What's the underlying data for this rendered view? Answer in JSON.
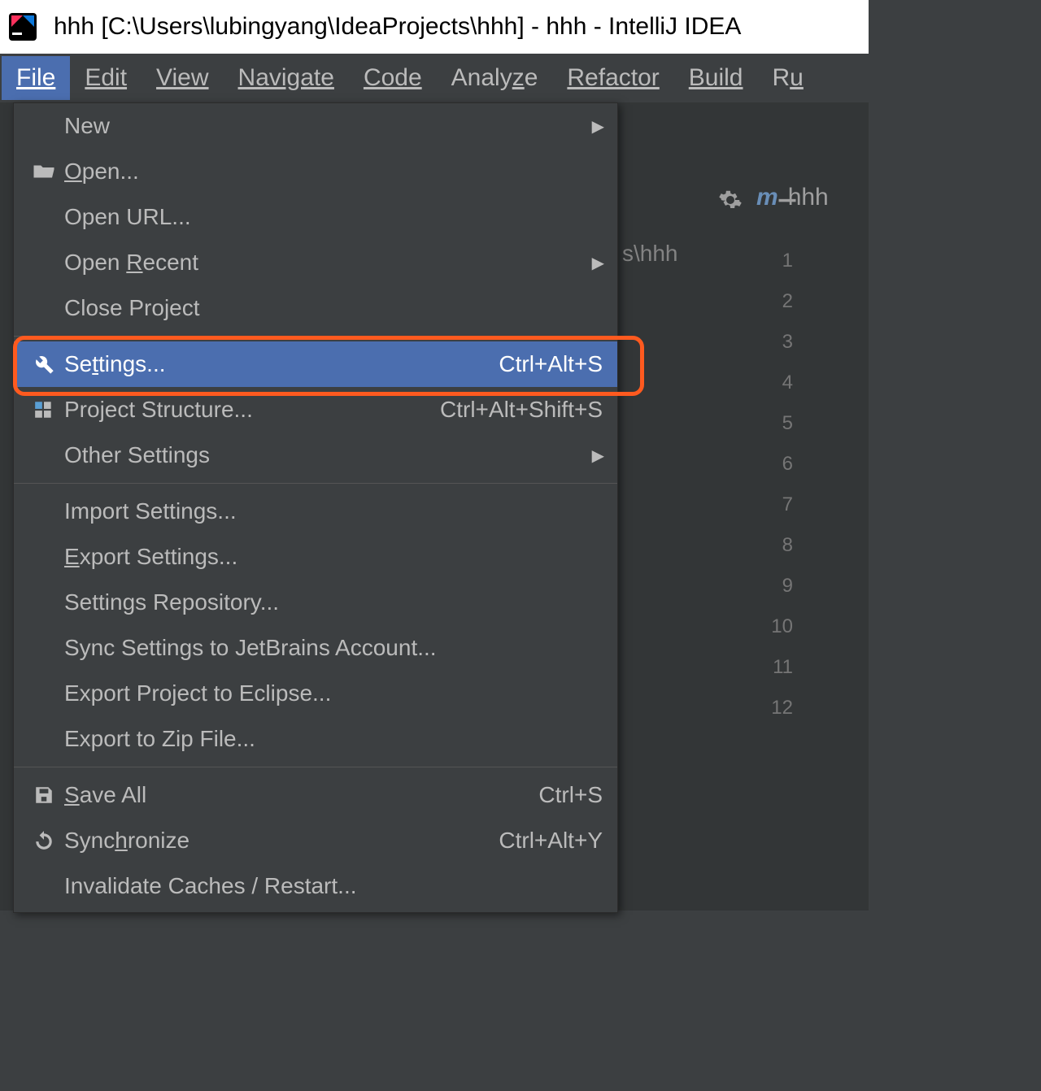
{
  "title": "hhh [C:\\Users\\lubingyang\\IdeaProjects\\hhh] - hhh - IntelliJ IDEA",
  "menubar": {
    "file": "File",
    "edit": "Edit",
    "view": "View",
    "navigate": "Navigate",
    "code": "Code",
    "analyze": "Analyze",
    "refactor": "Refactor",
    "build": "Build",
    "run": "Ru"
  },
  "dropdown": {
    "new": "New",
    "open": "Open...",
    "open_url": "Open URL...",
    "open_recent": "Open Recent",
    "close_project": "Close Project",
    "settings": "Settings...",
    "settings_shortcut": "Ctrl+Alt+S",
    "project_structure": "Project Structure...",
    "project_structure_shortcut": "Ctrl+Alt+Shift+S",
    "other_settings": "Other Settings",
    "import_settings": "Import Settings...",
    "export_settings": "Export Settings...",
    "settings_repository": "Settings Repository...",
    "sync_settings": "Sync Settings to JetBrains Account...",
    "export_eclipse": "Export Project to Eclipse...",
    "export_zip": "Export to Zip File...",
    "save_all": "Save All",
    "save_all_shortcut": "Ctrl+S",
    "synchronize": "Synchronize",
    "synchronize_shortcut": "Ctrl+Alt+Y",
    "invalidate": "Invalidate Caches / Restart..."
  },
  "workspace": {
    "breadcrumb_fragment": "s\\hhh",
    "tab_prefix": "m",
    "tab_name": "hhh",
    "line_numbers": [
      "1",
      "2",
      "3",
      "4",
      "5",
      "6",
      "7",
      "8",
      "9",
      "10",
      "11",
      "12"
    ]
  }
}
